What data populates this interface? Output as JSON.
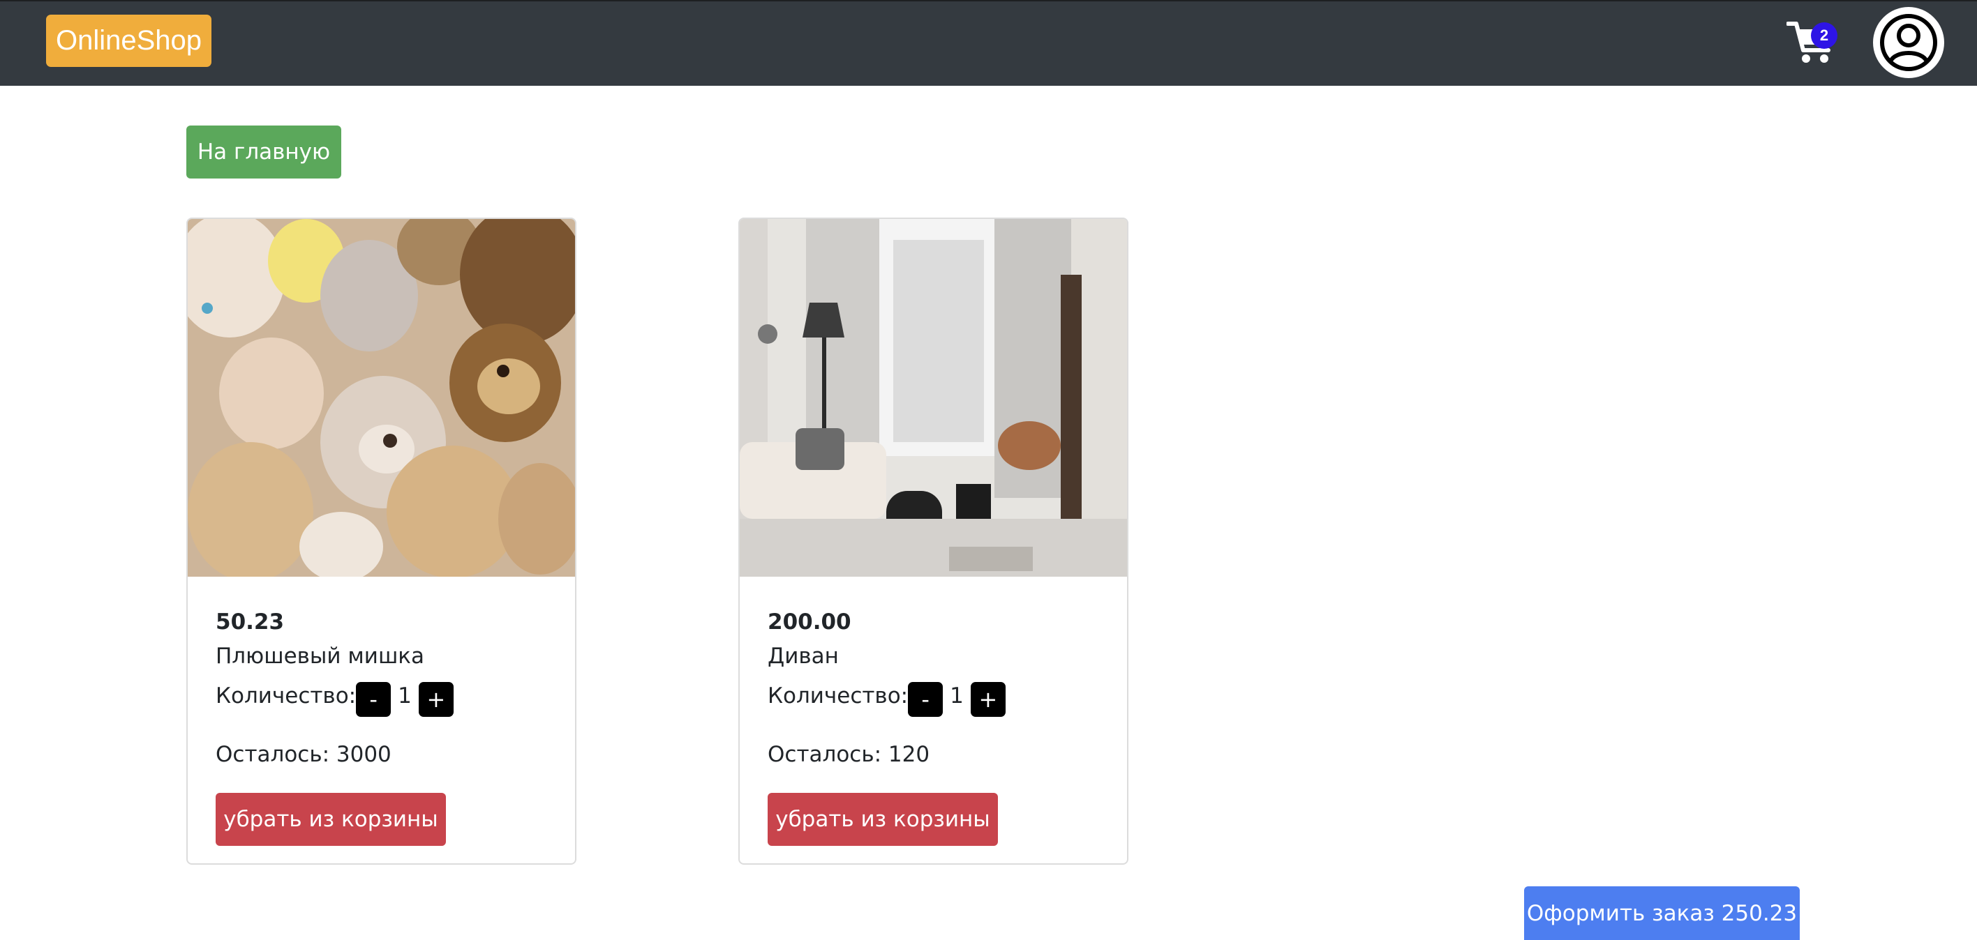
{
  "navbar": {
    "brand": "OnlineShop",
    "cart_icon": "cart-icon",
    "cart_count": "2",
    "profile_icon": "user-circle-icon",
    "colors": {
      "background": "#343a40",
      "brand": "#f0ad3c",
      "badge": "#2e14e6"
    }
  },
  "home_button": "На главную",
  "quantity_label": "Количество:",
  "minus_label": "-",
  "plus_label": "+",
  "remove_label": "убрать из корзины",
  "products": [
    {
      "price": "50.23",
      "name": "Плюшевый мишка",
      "quantity": "1",
      "remaining": "Осталось: 3000",
      "image": "plush-toys-photo"
    },
    {
      "price": "200.00",
      "name": "Диван",
      "quantity": "1",
      "remaining": "Осталось: 120",
      "image": "living-room-photo"
    }
  ],
  "checkout_button": "Оформить заказ 250.23",
  "colors": {
    "home_button": "#5ba85b",
    "remove_button": "#c8444c",
    "checkout_button": "#4d7ef0"
  }
}
